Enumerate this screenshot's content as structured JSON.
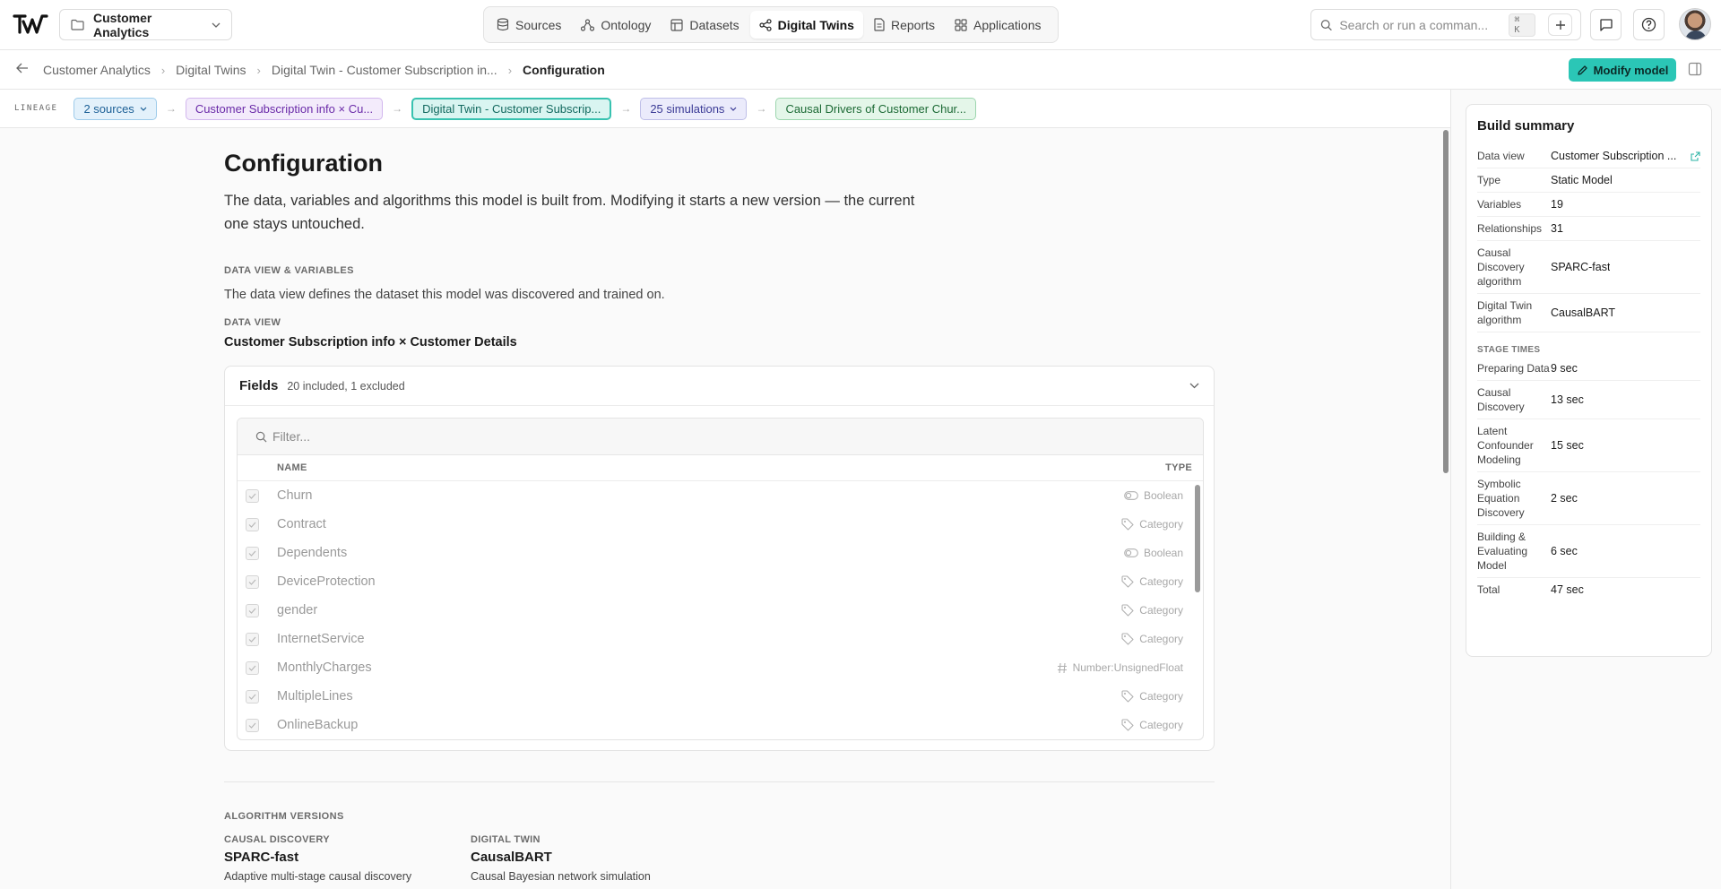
{
  "topbar": {
    "workspace": "Customer Analytics",
    "nav": [
      {
        "label": "Sources",
        "icon": "database-icon"
      },
      {
        "label": "Ontology",
        "icon": "ontology-icon"
      },
      {
        "label": "Datasets",
        "icon": "table-icon"
      },
      {
        "label": "Digital Twins",
        "icon": "share-nodes-icon",
        "active": true
      },
      {
        "label": "Reports",
        "icon": "document-icon"
      },
      {
        "label": "Applications",
        "icon": "grid-icon"
      }
    ],
    "search_placeholder": "Search or run a comman...",
    "search_shortcut": "⌘ K"
  },
  "breadcrumb": {
    "items": [
      "Customer Analytics",
      "Digital Twins",
      "Digital Twin - Customer Subscription in..."
    ],
    "current": "Configuration",
    "modify_label": "Modify model"
  },
  "lineage": {
    "label": "LINEAGE",
    "chips": [
      {
        "label": "2 sources",
        "style": "blue",
        "dropdown": true
      },
      {
        "label": "Customer Subscription info × Cu...",
        "style": "purple",
        "dropdown": false
      },
      {
        "label": "Digital Twin - Customer Subscrip...",
        "style": "teal",
        "dropdown": false
      },
      {
        "label": "25 simulations",
        "style": "lav",
        "dropdown": true
      },
      {
        "label": "Causal Drivers of Customer Chur...",
        "style": "green",
        "dropdown": false
      }
    ]
  },
  "page": {
    "title": "Configuration",
    "description": "The data, variables and algorithms this model is built from. Modifying it starts a new version — the current one stays untouched.",
    "section_variables": "DATA VIEW & VARIABLES",
    "section_variables_desc": "The data view defines the dataset this model was discovered and trained on.",
    "data_view_label": "DATA VIEW",
    "data_view_value": "Customer Subscription info × Customer Details"
  },
  "fields": {
    "title": "Fields",
    "count": "20 included, 1 excluded",
    "filter_placeholder": "Filter...",
    "col_name": "NAME",
    "col_type": "TYPE",
    "rows": [
      {
        "name": "Churn",
        "type": "Boolean",
        "icon": "toggle-icon"
      },
      {
        "name": "Contract",
        "type": "Category",
        "icon": "tag-icon"
      },
      {
        "name": "Dependents",
        "type": "Boolean",
        "icon": "toggle-icon"
      },
      {
        "name": "DeviceProtection",
        "type": "Category",
        "icon": "tag-icon"
      },
      {
        "name": "gender",
        "type": "Category",
        "icon": "tag-icon"
      },
      {
        "name": "InternetService",
        "type": "Category",
        "icon": "tag-icon"
      },
      {
        "name": "MonthlyCharges",
        "type": "Number:UnsignedFloat",
        "icon": "hash-icon"
      },
      {
        "name": "MultipleLines",
        "type": "Category",
        "icon": "tag-icon"
      },
      {
        "name": "OnlineBackup",
        "type": "Category",
        "icon": "tag-icon"
      }
    ]
  },
  "algorithms": {
    "section": "ALGORITHM VERSIONS",
    "causal_label": "CAUSAL DISCOVERY",
    "causal_value": "SPARC-fast",
    "causal_desc": "Adaptive multi-stage causal discovery",
    "twin_label": "DIGITAL TWIN",
    "twin_value": "CausalBART",
    "twin_desc": "Causal Bayesian network simulation"
  },
  "summary": {
    "title": "Build summary",
    "rows": [
      {
        "k": "Data view",
        "v": "Customer Subscription ...",
        "link": true
      },
      {
        "k": "Type",
        "v": "Static Model"
      },
      {
        "k": "Variables",
        "v": "19"
      },
      {
        "k": "Relationships",
        "v": "31"
      },
      {
        "k": "Causal Discovery algorithm",
        "v": "SPARC-fast"
      },
      {
        "k": "Digital Twin algorithm",
        "v": "CausalBART"
      }
    ],
    "stage_title": "STAGE TIMES",
    "stages": [
      {
        "k": "Preparing Data",
        "v": "9 sec"
      },
      {
        "k": "Causal Discovery",
        "v": "13 sec"
      },
      {
        "k": "Latent Confounder Modeling",
        "v": "15 sec"
      },
      {
        "k": "Symbolic Equation Discovery",
        "v": "2 sec"
      },
      {
        "k": "Building & Evaluating Model",
        "v": "6 sec"
      },
      {
        "k": "Total",
        "v": "47 sec"
      }
    ]
  }
}
